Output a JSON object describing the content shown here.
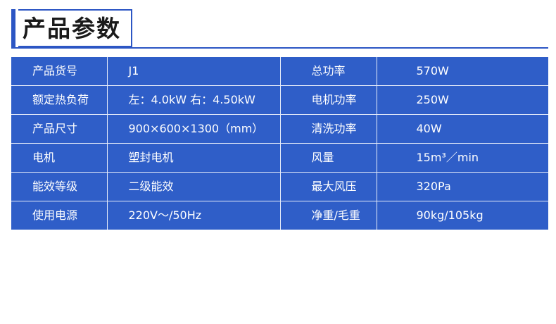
{
  "title": "产品参数",
  "colors": {
    "accent": "#2c56c4",
    "table_bg": "#2f5ec8",
    "table_text": "#ffffff",
    "divider": "#e6ecfa"
  },
  "rows": [
    {
      "label1": "产品货号",
      "value1": "J1",
      "label2": "总功率",
      "value2": "570W"
    },
    {
      "label1": "额定热负荷",
      "value1": "左：4.0kW  右：4.50kW",
      "label2": "电机功率",
      "value2": "250W"
    },
    {
      "label1": "产品尺寸",
      "value1": "900×600×1300（mm）",
      "label2": "清洗功率",
      "value2": "40W"
    },
    {
      "label1": "电机",
      "value1": "塑封电机",
      "label2": "风量",
      "value2": "15m³／min"
    },
    {
      "label1": "能效等级",
      "value1": "二级能效",
      "label2": "最大风压",
      "value2": "320Pa"
    },
    {
      "label1": "使用电源",
      "value1": "220V～/50Hz",
      "label2": "净重/毛重",
      "value2": "90kg/105kg"
    }
  ]
}
